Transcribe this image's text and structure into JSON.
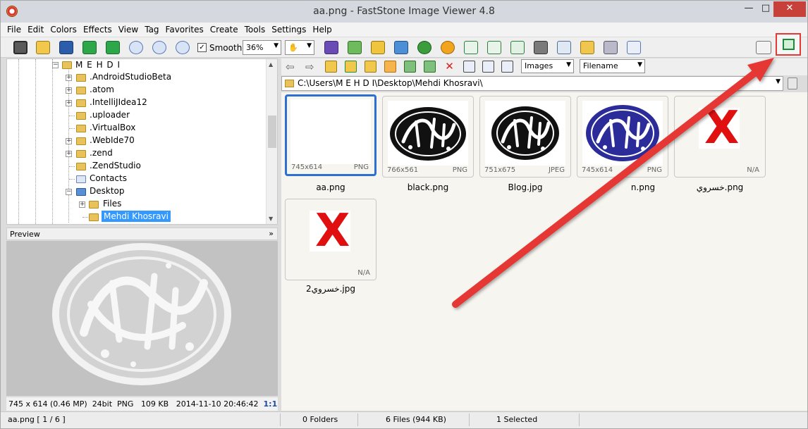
{
  "window": {
    "title": "aa.png  -  FastStone Image Viewer 4.8",
    "minimize": "—",
    "maximize": "□",
    "close": "✕"
  },
  "menu": [
    "File",
    "Edit",
    "Colors",
    "Effects",
    "View",
    "Tag",
    "Favorites",
    "Create",
    "Tools",
    "Settings",
    "Help"
  ],
  "toolbar": {
    "smooth_label": "Smooth",
    "smooth_checked": "✓",
    "zoom_value": "36%",
    "dropdown_arrow": "▼",
    "hand_glyph": "✋"
  },
  "tree": {
    "root": "M E H D I",
    "items": [
      ".AndroidStudioBeta",
      ".atom",
      ".IntelliJIdea12",
      ".uploader",
      ".VirtualBox",
      ".WebIde70",
      ".zend",
      ".ZendStudio",
      "Contacts",
      "Desktop",
      "Files",
      "Mehdi Khosravi"
    ]
  },
  "preview": {
    "header": "Preview",
    "collapse": "»",
    "info": {
      "dimensions": "745 x 614 (0.46 MP)",
      "bitdepth": "24bit",
      "format": "PNG",
      "size": "109 KB",
      "date": "2014-11-10 20:46:42",
      "ratio": "1:1"
    }
  },
  "nav": {
    "filter_value": "Images",
    "sort_value": "Filename"
  },
  "path": {
    "value": "C:\\Users\\M E H D I\\Desktop\\Mehdi Khosravi\\"
  },
  "thumbnails": [
    {
      "name": "aa.png",
      "dims": "745x614",
      "format": "PNG",
      "style": "blank"
    },
    {
      "name": "black.png",
      "dims": "766x561",
      "format": "PNG",
      "style": "black"
    },
    {
      "name": "Blog.jpg",
      "dims": "751x675",
      "format": "JPEG",
      "style": "black"
    },
    {
      "name": "n.png",
      "dims": "745x614",
      "format": "PNG",
      "style": "blue"
    },
    {
      "name": "خسروي.png",
      "dims": "",
      "format": "N/A",
      "style": "x"
    },
    {
      "name": "خسروي2.jpg",
      "dims": "",
      "format": "N/A",
      "style": "x"
    }
  ],
  "x_mark": "X",
  "status": {
    "file": "aa.png [ 1 / 6 ]",
    "folders": "0 Folders",
    "files": "6 Files (944 KB)",
    "selected": "1 Selected"
  },
  "colors": {
    "selection": "#2d6fd2",
    "arrow": "#e53935",
    "logo_blue": "#2b2b9a"
  }
}
